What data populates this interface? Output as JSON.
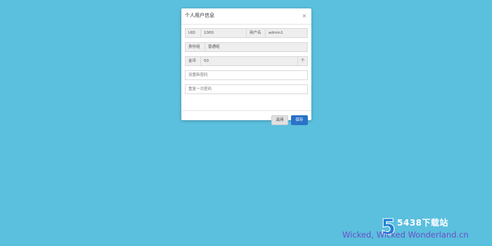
{
  "modal": {
    "title": "个人用户信息",
    "close_icon": "×",
    "uid_label": "UID",
    "uid_value": "1000",
    "username_label": "用户名",
    "username_value": "admin1",
    "identity_label": "身份组",
    "identity_value": "普通组",
    "coins_label": "金币",
    "coins_value": "50",
    "coins_unit": "个",
    "new_password_placeholder": "设置新密码",
    "repeat_password_placeholder": "重复一次密码",
    "close_button": "关闭",
    "save_button": "保存"
  },
  "watermark": {
    "logo": "5",
    "site": "5438下载站",
    "caption": "Wicked, Wicked Wonderland.cn"
  },
  "colors": {
    "background": "#5bbfde",
    "primary": "#2a72c8",
    "watermark_text": "#6a4fc8"
  }
}
